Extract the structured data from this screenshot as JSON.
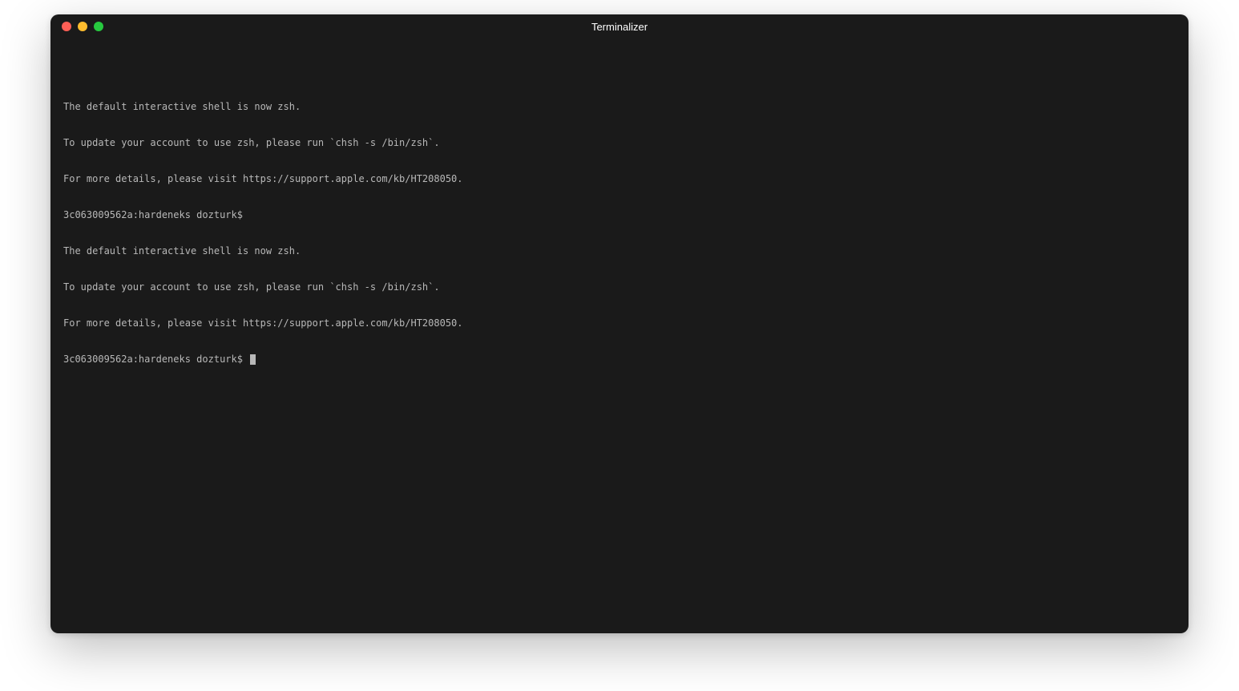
{
  "window": {
    "title": "Terminalizer"
  },
  "terminal": {
    "lines": [
      "The default interactive shell is now zsh.",
      "To update your account to use zsh, please run `chsh -s /bin/zsh`.",
      "For more details, please visit https://support.apple.com/kb/HT208050.",
      "3c063009562a:hardeneks dozturk$",
      "The default interactive shell is now zsh.",
      "To update your account to use zsh, please run `chsh -s /bin/zsh`.",
      "For more details, please visit https://support.apple.com/kb/HT208050."
    ],
    "prompt": "3c063009562a:hardeneks dozturk$ "
  }
}
